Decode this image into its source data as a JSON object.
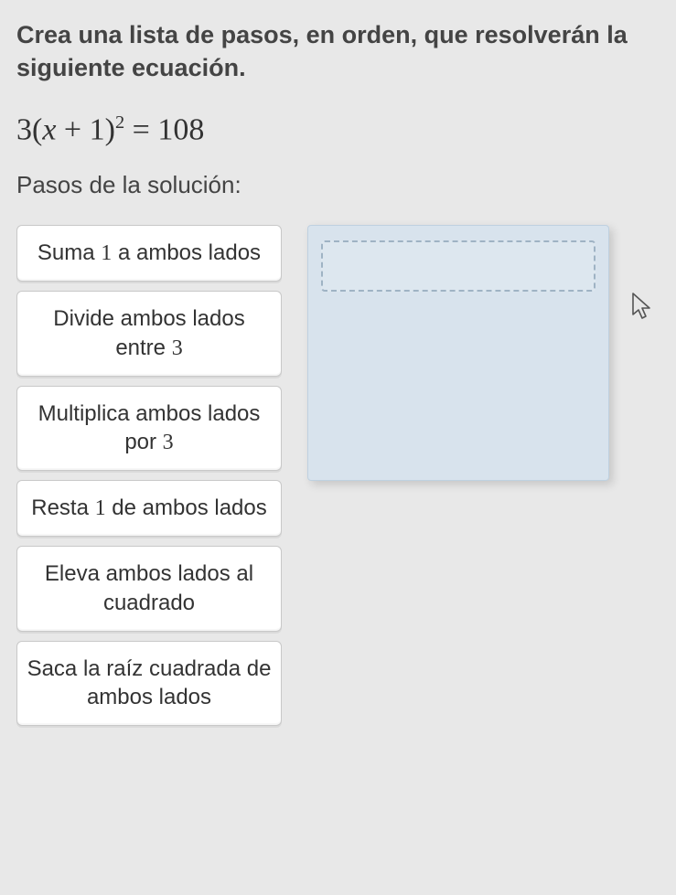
{
  "instruction": "Crea una lista de pasos, en orden, que resolverán la siguiente ecuación.",
  "equation": {
    "coef": "3",
    "open": "(",
    "var": "x",
    "plus": " + ",
    "const": "1",
    "close": ")",
    "exp": "2",
    "eq": " = ",
    "rhs": "108"
  },
  "steps_label": "Pasos de la solución:",
  "options": [
    {
      "pre": "Suma ",
      "num": "1",
      "post": " a ambos lados"
    },
    {
      "pre": "Divide ambos lados entre ",
      "num": "3",
      "post": ""
    },
    {
      "pre": "Multiplica ambos lados por ",
      "num": "3",
      "post": ""
    },
    {
      "pre": "Resta ",
      "num": "1",
      "post": " de ambos lados"
    },
    {
      "pre": "Eleva ambos lados al cuadrado",
      "num": "",
      "post": ""
    },
    {
      "pre": "Saca la raíz cuadrada de ambos lados",
      "num": "",
      "post": ""
    }
  ]
}
